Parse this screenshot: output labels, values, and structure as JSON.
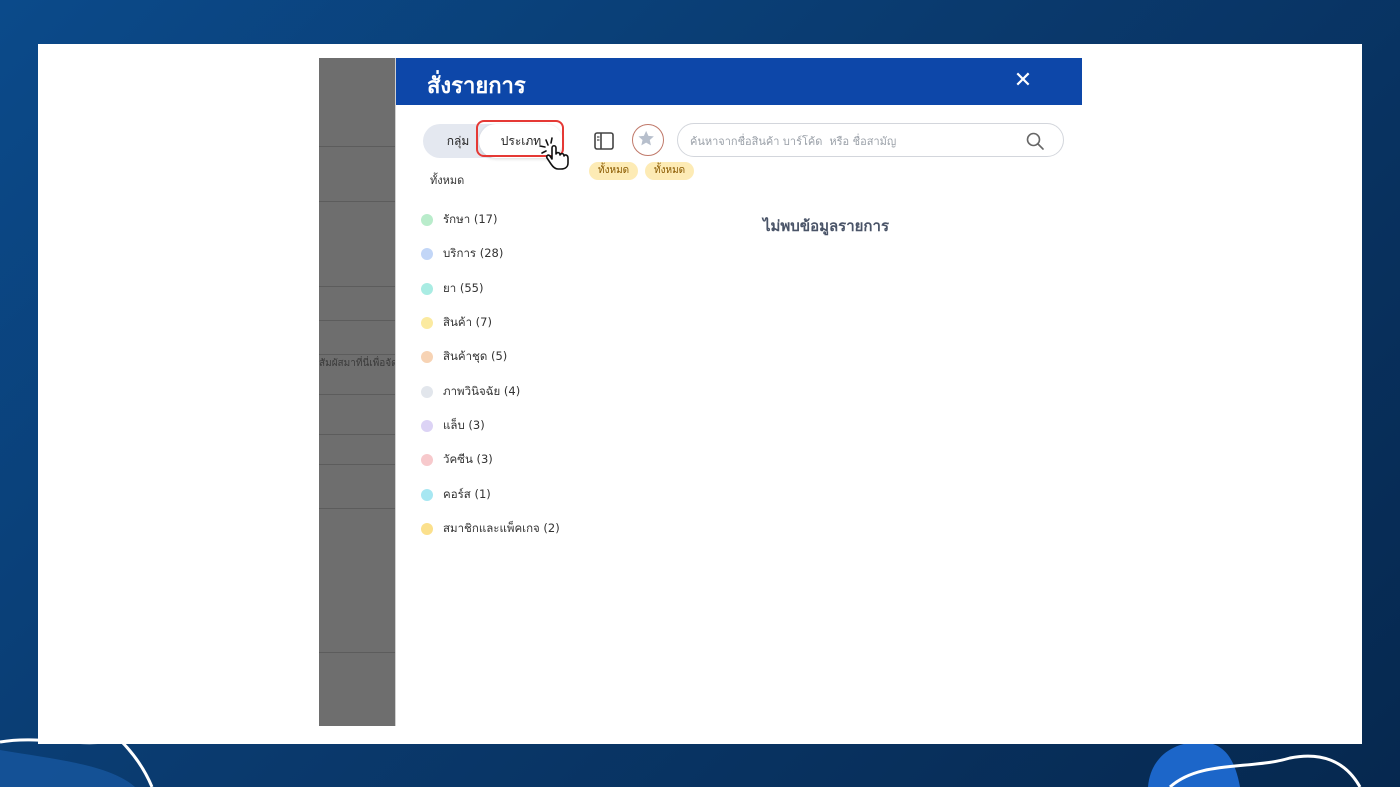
{
  "modal": {
    "title": "สั่งรายการ",
    "close_icon": "close-icon",
    "close_glyph": "✕"
  },
  "background_app": {
    "snippet": "สัมผัสมาที่นี่เพื่อจัด"
  },
  "toolbar": {
    "toggle": {
      "group_label": "กลุ่ม",
      "type_label": "ประเภท",
      "selected": "ประเภท"
    },
    "layout_icon": "sidebar-layout-icon",
    "favorite_icon": "star-icon",
    "search": {
      "placeholder": "ค้นหาจากชื่อสินค้า บาร์โค้ด  หรือ ชื่อสามัญ",
      "value": "",
      "icon": "search-icon"
    },
    "chips": [
      "ทั้งหมด",
      "ทั้งหมด"
    ]
  },
  "categories": {
    "all_label": "ทั้งหมด",
    "items": [
      {
        "label": "รักษา (17)",
        "color": "#b9eccb"
      },
      {
        "label": "บริการ (28)",
        "color": "#c2d6f7"
      },
      {
        "label": "ยา (55)",
        "color": "#a9ece3"
      },
      {
        "label": "สินค้า (7)",
        "color": "#fbeaa0"
      },
      {
        "label": "สินค้าชุด (5)",
        "color": "#f7d3b4"
      },
      {
        "label": "ภาพวินิจฉัย (4)",
        "color": "#e2e6ec"
      },
      {
        "label": "แล็บ (3)",
        "color": "#dcd3f5"
      },
      {
        "label": "วัคซีน (3)",
        "color": "#f7c9cc"
      },
      {
        "label": "คอร์ส (1)",
        "color": "#a7e7f2"
      },
      {
        "label": "สมาชิกและแพ็คเกจ (2)",
        "color": "#fbe08c"
      }
    ]
  },
  "main": {
    "empty_message": "ไม่พบข้อมูลรายการ"
  },
  "colors": {
    "header": "#0d47a9",
    "highlight": "#e53935",
    "chip_bg": "#fdebb5"
  }
}
